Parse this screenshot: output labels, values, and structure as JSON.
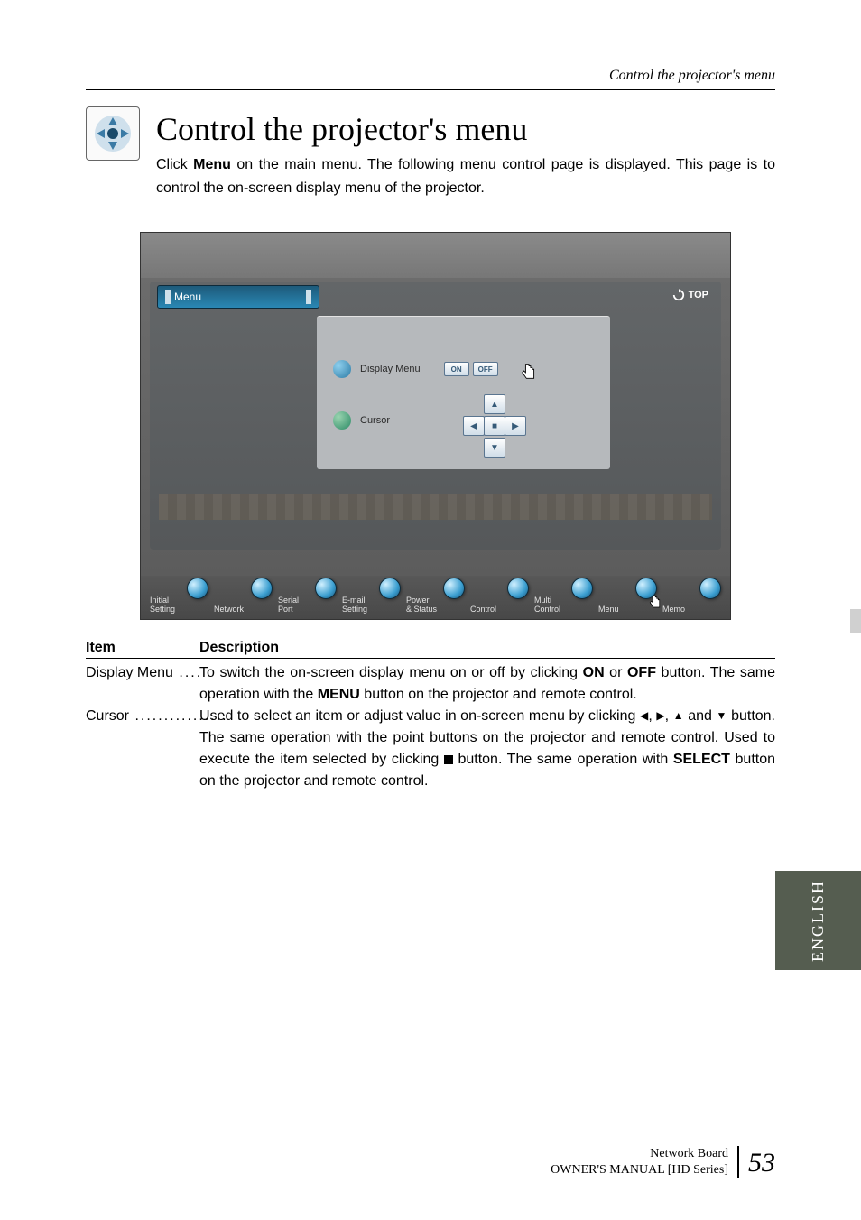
{
  "running_header": "Control the projector's menu",
  "title": "Control the projector's menu",
  "intro_parts": {
    "pre": "Click ",
    "bold": "Menu",
    "post": " on the main menu. The following menu control page is displayed. This page is to control the on-screen display menu of the projector."
  },
  "app": {
    "tab_label": "Menu",
    "top_link": "TOP",
    "display_menu_label": "Display Menu",
    "on_label": "ON",
    "off_label": "OFF",
    "cursor_label": "Cursor",
    "nav": [
      "Initial\nSetting",
      "Network",
      "Serial\nPort",
      "E-mail\nSetting",
      "Power\n& Status",
      "Control",
      "Multi\nControl",
      "Menu",
      "Memo"
    ]
  },
  "table": {
    "h1": "Item",
    "h2": "Description",
    "rows": [
      {
        "item": "Display Menu",
        "dots": "....",
        "desc_segments": [
          {
            "t": "To switch the on-screen display menu on or off by clicking "
          },
          {
            "t": "ON",
            "b": true
          },
          {
            "t": " or "
          },
          {
            "t": "OFF",
            "b": true
          },
          {
            "t": " button. The same operation with the "
          },
          {
            "t": "MENU",
            "b": true
          },
          {
            "t": " button on the projector and remote control."
          }
        ]
      },
      {
        "item": "Cursor",
        "dots": "................",
        "desc_segments": [
          {
            "t": "Used to select an item or adjust value in on-screen menu by clicking "
          },
          {
            "sym": "◀"
          },
          {
            "t": ", "
          },
          {
            "sym": "▶"
          },
          {
            "t": ", "
          },
          {
            "sym": "▲"
          },
          {
            "t": " and "
          },
          {
            "sym": "▼"
          },
          {
            "t": " button. The same operation with the point buttons on the projector and remote control. Used to execute the item selected by clicking "
          },
          {
            "sq": true
          },
          {
            "t": " button. The same operation with "
          },
          {
            "t": "SELECT",
            "b": true
          },
          {
            "t": " button on the projector and remote control."
          }
        ]
      }
    ]
  },
  "side_tab": "ENGLISH",
  "footer": {
    "line1": "Network Board",
    "line2": "OWNER'S MANUAL [HD Series]",
    "page": "53"
  }
}
